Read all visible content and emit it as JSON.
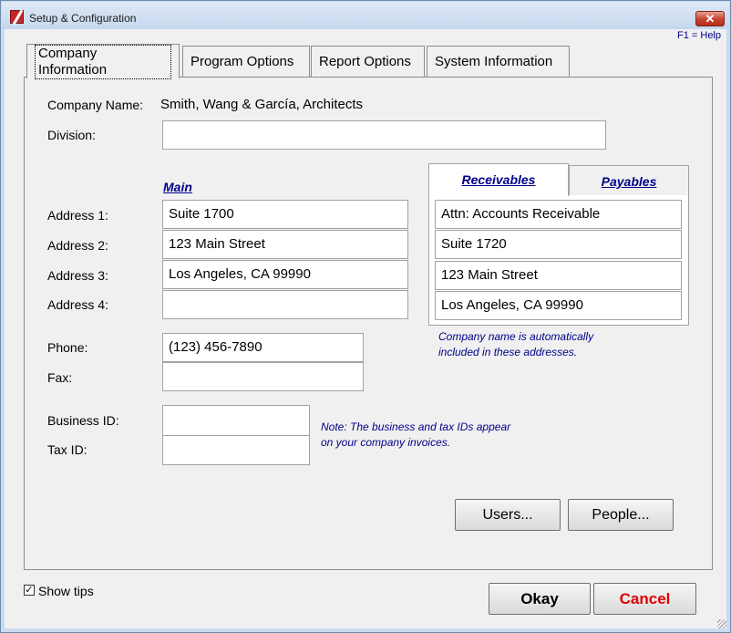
{
  "window": {
    "title": "Setup & Configuration",
    "close_glyph": "✕",
    "help": "F1 = Help"
  },
  "tabs": [
    {
      "label": "Company Information",
      "active": true
    },
    {
      "label": "Program Options",
      "active": false
    },
    {
      "label": "Report Options",
      "active": false
    },
    {
      "label": "System Information",
      "active": false
    }
  ],
  "company": {
    "name_label": "Company Name:",
    "name_value": "Smith, Wang & García, Architects",
    "division_label": "Division:",
    "division_value": ""
  },
  "main_address": {
    "heading": "Main",
    "labels": [
      "Address 1:",
      "Address 2:",
      "Address 3:",
      "Address 4:"
    ],
    "values": [
      "Suite 1700",
      "123 Main Street",
      "Los Angeles, CA 99990",
      ""
    ]
  },
  "alt_address": {
    "tabs": [
      "Receivables",
      "Payables"
    ],
    "active_tab": "Receivables",
    "values": [
      "Attn: Accounts Receivable",
      "Suite 1720",
      "123 Main Street",
      "Los Angeles, CA 99990"
    ],
    "note": [
      "Company name is automatically",
      "included in these addresses."
    ]
  },
  "contact": {
    "phone_label": "Phone:",
    "phone_value": "(123) 456-7890",
    "fax_label": "Fax:",
    "fax_value": ""
  },
  "ids": {
    "business_label": "Business ID:",
    "business_value": "",
    "tax_label": "Tax ID:",
    "tax_value": "",
    "note": [
      "Note: The business and tax IDs appear",
      "on your company invoices."
    ]
  },
  "buttons": {
    "users": "Users...",
    "people": "People...",
    "okay": "Okay",
    "cancel": "Cancel"
  },
  "show_tips": {
    "label": "Show tips",
    "checked": true,
    "glyph": "✓"
  },
  "colors": {
    "accent_text": "#00008b",
    "cancel_text": "#e00000"
  }
}
